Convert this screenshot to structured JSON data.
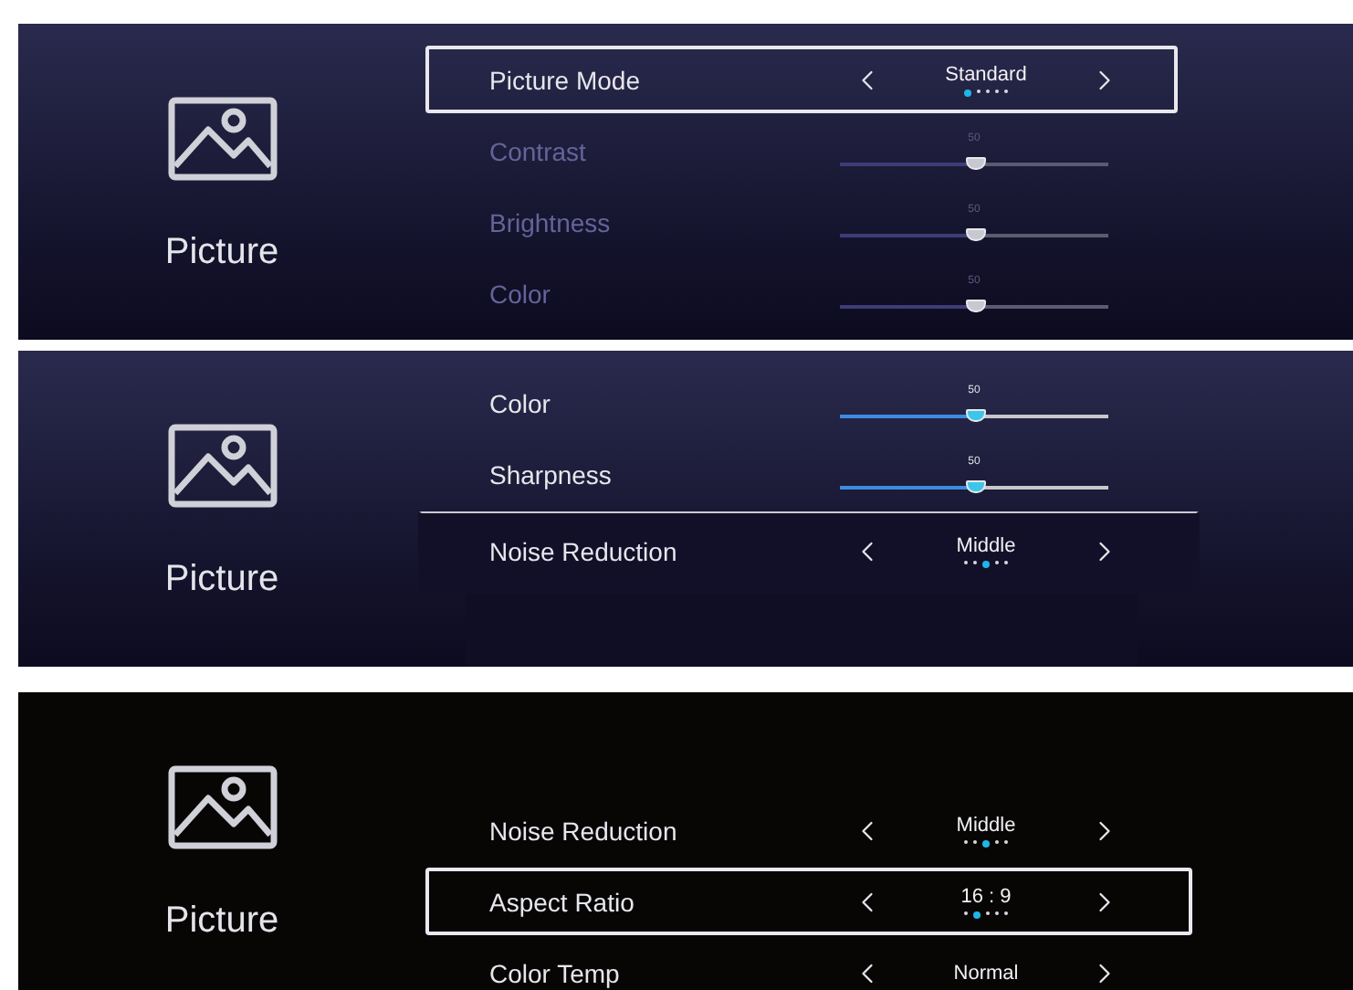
{
  "panels": [
    {
      "kind": "navy",
      "category": "Picture",
      "popup": false,
      "rows": [
        {
          "kind": "option",
          "label": "Picture Mode",
          "selected": true,
          "dimmed": false,
          "value": "Standard",
          "dots": [
            {
              "selected": true
            },
            {
              "selected": false
            },
            {
              "selected": false
            },
            {
              "selected": false
            },
            {
              "selected": false
            }
          ]
        },
        {
          "kind": "slider",
          "label": "Contrast",
          "selected": false,
          "dimmed": true,
          "level": 0.5,
          "reading": "50"
        },
        {
          "kind": "slider",
          "label": "Brightness",
          "selected": false,
          "dimmed": true,
          "level": 0.5,
          "reading": "50"
        },
        {
          "kind": "slider",
          "label": "Color",
          "selected": false,
          "dimmed": true,
          "level": 0.5,
          "reading": "50"
        }
      ]
    },
    {
      "kind": "navy",
      "category": "Picture",
      "popup": true,
      "rows": [
        {
          "kind": "slider",
          "label": "Color",
          "selected": false,
          "dimmed": false,
          "level": 0.5,
          "reading": "50"
        },
        {
          "kind": "slider",
          "label": "Sharpness",
          "selected": false,
          "dimmed": false,
          "level": 0.5,
          "reading": "50"
        },
        {
          "kind": "option",
          "label": "Noise Reduction",
          "selected": true,
          "dimmed": false,
          "value": "Middle",
          "dots": [
            {
              "selected": false
            },
            {
              "selected": false
            },
            {
              "selected": true
            },
            {
              "selected": false
            },
            {
              "selected": false
            }
          ]
        }
      ]
    },
    {
      "kind": "black",
      "category": "Picture",
      "popup": false,
      "rows": [
        {
          "kind": "option",
          "label": "Noise Reduction",
          "selected": false,
          "dimmed": false,
          "value": "Middle",
          "dots": [
            {
              "selected": false
            },
            {
              "selected": false
            },
            {
              "selected": true
            },
            {
              "selected": false
            },
            {
              "selected": false
            }
          ]
        },
        {
          "kind": "option",
          "label": "Aspect Ratio",
          "selected": true,
          "dimmed": false,
          "value": "16 : 9",
          "dots": [
            {
              "selected": false
            },
            {
              "selected": true
            },
            {
              "selected": false
            },
            {
              "selected": false
            },
            {
              "selected": false
            }
          ]
        },
        {
          "kind": "option",
          "label": "Color Temp",
          "selected": false,
          "dimmed": false,
          "value": "Normal",
          "dots": []
        }
      ]
    }
  ]
}
